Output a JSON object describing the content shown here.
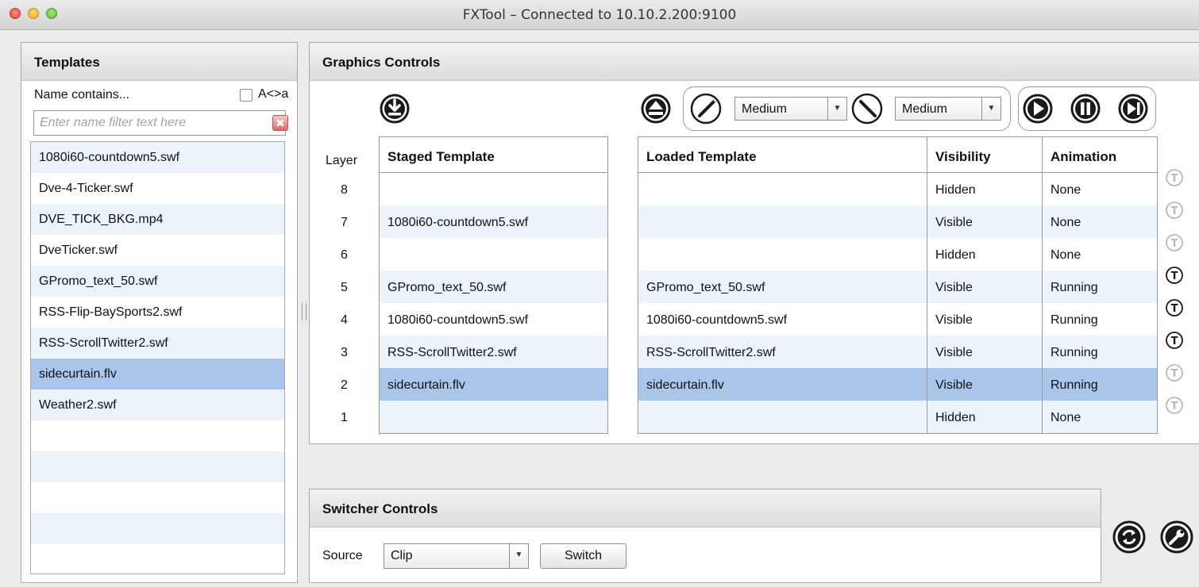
{
  "window": {
    "title": "FXTool – Connected to 10.10.2.200:9100"
  },
  "templates": {
    "title": "Templates",
    "filter_label": "Name contains...",
    "case_label": "A<>a",
    "filter_placeholder": "Enter name filter text here",
    "items": [
      "1080i60-countdown5.swf",
      "Dve-4-Ticker.swf",
      "DVE_TICK_BKG.mp4",
      "DveTicker.swf",
      "GPromo_text_50.swf",
      "RSS-Flip-BaySports2.swf",
      "RSS-ScrollTwitter2.swf",
      "sidecurtain.flv",
      "Weather2.swf",
      "",
      "",
      "",
      "",
      ""
    ],
    "selected_index": 7
  },
  "graphics": {
    "title": "Graphics Controls",
    "speed_out": "Medium",
    "speed_in": "Medium",
    "layer_header": "Layer",
    "columns": {
      "staged": "Staged Template",
      "loaded": "Loaded Template",
      "visibility": "Visibility",
      "animation": "Animation"
    },
    "rows": [
      {
        "layer": "8",
        "staged": "",
        "loaded": "",
        "visibility": "Hidden",
        "animation": "None",
        "text_enabled": false
      },
      {
        "layer": "7",
        "staged": "1080i60-countdown5.swf",
        "loaded": "",
        "visibility": "Visible",
        "animation": "None",
        "text_enabled": false
      },
      {
        "layer": "6",
        "staged": "",
        "loaded": "",
        "visibility": "Hidden",
        "animation": "None",
        "text_enabled": false
      },
      {
        "layer": "5",
        "staged": "GPromo_text_50.swf",
        "loaded": "GPromo_text_50.swf",
        "visibility": "Visible",
        "animation": "Running",
        "text_enabled": true
      },
      {
        "layer": "4",
        "staged": "1080i60-countdown5.swf",
        "loaded": "1080i60-countdown5.swf",
        "visibility": "Visible",
        "animation": "Running",
        "text_enabled": true
      },
      {
        "layer": "3",
        "staged": "RSS-ScrollTwitter2.swf",
        "loaded": "RSS-ScrollTwitter2.swf",
        "visibility": "Visible",
        "animation": "Running",
        "text_enabled": true
      },
      {
        "layer": "2",
        "staged": "sidecurtain.flv",
        "loaded": "sidecurtain.flv",
        "visibility": "Visible",
        "animation": "Running",
        "text_enabled": false
      },
      {
        "layer": "1",
        "staged": "",
        "loaded": "",
        "visibility": "Hidden",
        "animation": "None",
        "text_enabled": false
      }
    ],
    "selected_row": 6,
    "text_glyph": "T"
  },
  "switcher": {
    "title": "Switcher Controls",
    "source_label": "Source",
    "source_value": "Clip",
    "switch_label": "Switch"
  },
  "icons": {
    "load": "download-icon",
    "eject": "eject-icon",
    "fade_out": "fade-out-icon",
    "fade_in": "fade-in-icon",
    "play": "play-icon",
    "pause": "pause-icon",
    "next": "step-forward-icon",
    "refresh": "refresh-icon",
    "settings": "wrench-icon"
  },
  "colors": {
    "selection": "#a9c6ea",
    "alt_row": "#edf3fb",
    "icon_dark": "#1a1a1a",
    "icon_disabled": "#b8b8b8"
  }
}
